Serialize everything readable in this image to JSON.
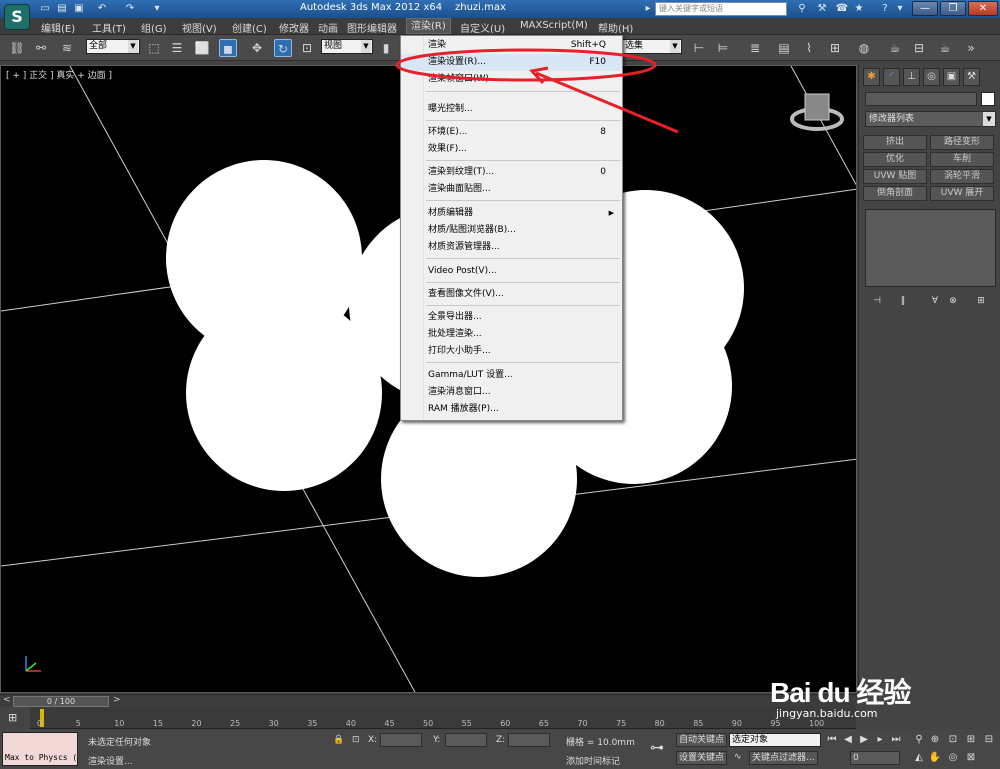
{
  "titlebar": {
    "title": "Autodesk 3ds Max  2012 x64",
    "file": "zhuzi.max",
    "search_placeholder": "键入关键字或短语"
  },
  "menubar": {
    "items": [
      "编辑(E)",
      "工具(T)",
      "组(G)",
      "视图(V)",
      "创建(C)",
      "修改器",
      "动画",
      "图形编辑器",
      "渲染(R)",
      "自定义(U)",
      "MAXScript(M)",
      "帮助(H)"
    ]
  },
  "toolbar": {
    "selection_filter": "全部",
    "ref_coord": "视图",
    "named_selection": "选集"
  },
  "viewport": {
    "label": "[ + ] 正交 ] 真实 + 边面 ]"
  },
  "render_menu": {
    "items": [
      {
        "label": "渲染",
        "shortcut": "Shift+Q"
      },
      {
        "label": "渲染设置(R)...",
        "shortcut": "F10"
      },
      {
        "label": "渲染帧窗口(W)...",
        "shortcut": ""
      },
      {
        "label": "曝光控制...",
        "shortcut": ""
      },
      {
        "label": "环境(E)...",
        "shortcut": "8"
      },
      {
        "label": "效果(F)...",
        "shortcut": ""
      },
      {
        "label": "渲染到纹理(T)...",
        "shortcut": "0"
      },
      {
        "label": "渲染曲面贴图...",
        "shortcut": ""
      },
      {
        "label": "材质编辑器",
        "shortcut": ""
      },
      {
        "label": "材质/贴图浏览器(B)...",
        "shortcut": ""
      },
      {
        "label": "材质资源管理器...",
        "shortcut": ""
      },
      {
        "label": "Video Post(V)...",
        "shortcut": ""
      },
      {
        "label": "查看图像文件(V)...",
        "shortcut": ""
      },
      {
        "label": "全景导出器...",
        "shortcut": ""
      },
      {
        "label": "批处理渲染...",
        "shortcut": ""
      },
      {
        "label": "打印大小助手...",
        "shortcut": ""
      },
      {
        "label": "Gamma/LUT 设置...",
        "shortcut": ""
      },
      {
        "label": "渲染消息窗口...",
        "shortcut": ""
      },
      {
        "label": "RAM 播放器(P)...",
        "shortcut": ""
      }
    ]
  },
  "command_panel": {
    "modifier_list": "修改器列表",
    "buttons": [
      "挤出",
      "路径变形",
      "优化",
      "车削",
      "UVW 贴图",
      "涡轮平滑",
      "倒角剖面",
      "UVW 展开"
    ]
  },
  "timeline": {
    "frame": "0 / 100",
    "ticks": [
      "0",
      "5",
      "10",
      "15",
      "20",
      "25",
      "30",
      "35",
      "40",
      "45",
      "50",
      "55",
      "60",
      "65",
      "70",
      "75",
      "80",
      "85",
      "90",
      "95",
      "100"
    ]
  },
  "statusbar": {
    "maxscript": "Max to Physcs (",
    "status": "未选定任何对象",
    "prompt": "渲染设置...",
    "x_label": "X:",
    "y_label": "Y:",
    "z_label": "Z:",
    "grid": "栅格 = 10.0mm",
    "add_time_tag": "添加时间标记",
    "auto_key": "自动关键点",
    "selected": "选定对象",
    "set_key": "设置关键点",
    "key_filters": "关键点过滤器...",
    "frame_value": "0"
  },
  "watermark": {
    "logo": "Bai du 经验",
    "url": "jingyan.baidu.com"
  },
  "colors": {
    "highlight_red": "#e8202a",
    "active_blue": "#2d6fb0"
  }
}
